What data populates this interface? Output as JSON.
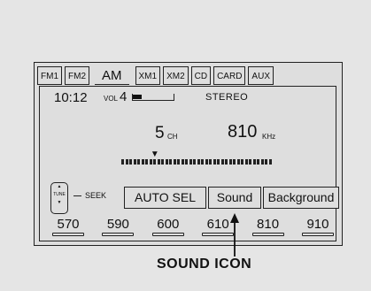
{
  "tabs": [
    "FM1",
    "FM2",
    "AM",
    "XM1",
    "XM2",
    "CD",
    "CARD",
    "AUX"
  ],
  "active_tab": "AM",
  "display": {
    "time": "10:12",
    "vol_label": "VOL",
    "vol_value": "4",
    "vol_level_fraction": 0.12,
    "stereo": "STEREO",
    "channel": "5",
    "channel_unit": "CH",
    "frequency": "810",
    "frequency_unit": "KHz",
    "tuner_position_fraction": 0.21,
    "tuner_tick_count": 38
  },
  "controls": {
    "tune_up": "▲",
    "tune_label": "TUNE",
    "tune_down": "▼",
    "seek_label": "SEEK"
  },
  "buttons": {
    "auto_sel": "AUTO SEL",
    "sound": "Sound",
    "background": "Background"
  },
  "presets": [
    "570",
    "590",
    "600",
    "610",
    "810",
    "910"
  ],
  "callout": "SOUND ICON"
}
